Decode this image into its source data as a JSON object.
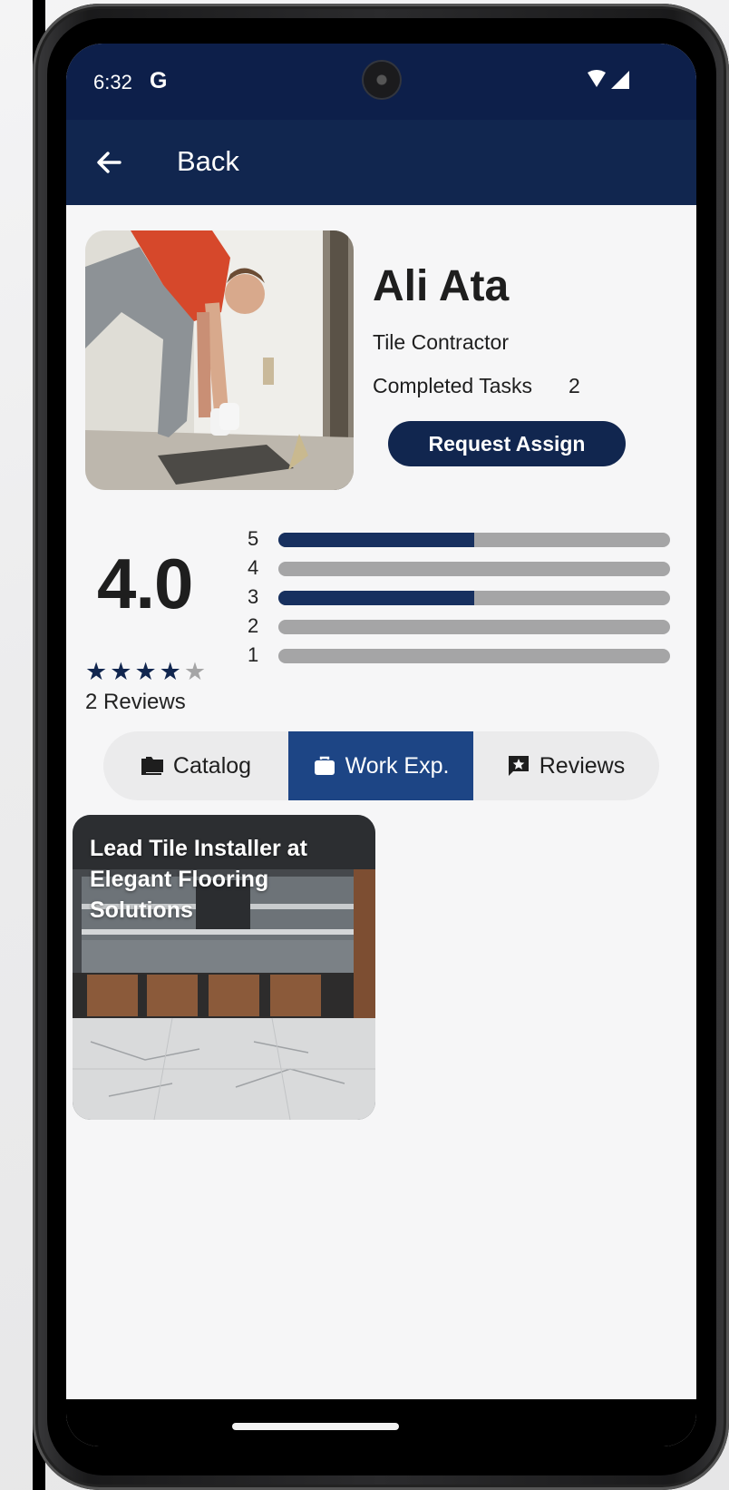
{
  "status_bar": {
    "time": "6:32",
    "g_logo": "G"
  },
  "app_bar": {
    "back_label": "Back",
    "back_icon": "arrow-left-icon"
  },
  "profile": {
    "name": "Ali Ata",
    "role": "Tile Contractor",
    "completed_tasks_label": "Completed Tasks",
    "completed_tasks_count": "2",
    "request_button_label": "Request Assign"
  },
  "rating": {
    "average": "4.0",
    "stars_filled": 4,
    "stars_total": 5,
    "reviews_label": "2 Reviews",
    "distribution": [
      {
        "stars": "5",
        "fraction": 0.5
      },
      {
        "stars": "4",
        "fraction": 0
      },
      {
        "stars": "3",
        "fraction": 0.5
      },
      {
        "stars": "2",
        "fraction": 0
      },
      {
        "stars": "1",
        "fraction": 0
      }
    ]
  },
  "tabs": [
    {
      "label": "Catalog",
      "icon": "folder-icon",
      "active": false
    },
    {
      "label": "Work Exp.",
      "icon": "briefcase-icon",
      "active": true
    },
    {
      "label": "Reviews",
      "icon": "review-star-icon",
      "active": false
    }
  ],
  "work_experience": [
    {
      "title": "Lead Tile Installer at Elegant Flooring Solutions"
    }
  ],
  "colors": {
    "primary": "#11264f",
    "active_tab": "#1d4585",
    "bar_fill": "#17305f",
    "bar_track": "#a5a5a6",
    "star_filled": "#11264f",
    "star_empty": "#a5a5a6"
  }
}
